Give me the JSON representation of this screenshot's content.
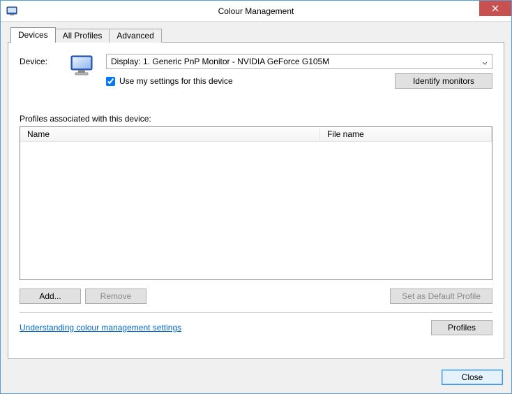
{
  "window": {
    "title": "Colour Management"
  },
  "tabs": {
    "devices": "Devices",
    "all_profiles": "All Profiles",
    "advanced": "Advanced"
  },
  "device_section": {
    "label": "Device:",
    "selected": "Display: 1. Generic PnP Monitor - NVIDIA GeForce G105M",
    "use_my_settings_label": "Use my settings for this device",
    "use_my_settings_checked": true,
    "identify_button": "Identify monitors"
  },
  "profiles_section": {
    "heading": "Profiles associated with this device:",
    "columns": {
      "name": "Name",
      "file": "File name"
    },
    "rows": []
  },
  "buttons": {
    "add": "Add...",
    "remove": "Remove",
    "set_default": "Set as Default Profile",
    "profiles": "Profiles",
    "close": "Close"
  },
  "link": {
    "understanding": "Understanding colour management settings"
  }
}
